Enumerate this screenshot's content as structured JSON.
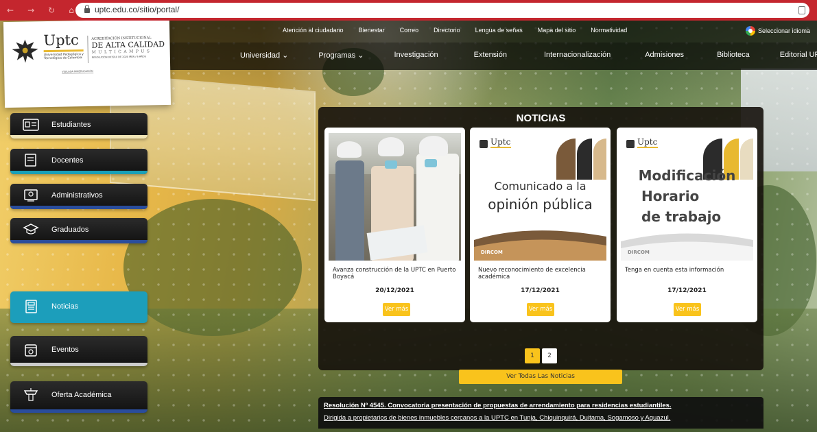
{
  "browser": {
    "url": "uptc.edu.co/sitio/portal/",
    "nav_glyphs": [
      "←",
      "→",
      "↻",
      "⌂"
    ]
  },
  "topbar": {
    "links": [
      "Atención al ciudadano",
      "Bienestar",
      "Correo",
      "Directorio",
      "Lengua de señas",
      "Mapa del sitio",
      "Normatividad"
    ],
    "language": "Seleccionar idioma"
  },
  "mainnav": {
    "items": [
      "Universidad ⌄",
      "Programas ⌄",
      "Investigación",
      "Extensión",
      "Internacionalización",
      "Admisiones",
      "Biblioteca",
      "Editorial UPTC"
    ]
  },
  "logo": {
    "wordmark": "Uptc",
    "university": "Universidad Pedagógica y Tecnológica de Colombia",
    "acred_small": "ACREDITACIÓN INSTITUCIONAL",
    "acred_big": "DE ALTA CALIDAD",
    "multicampus": "MULTICAMPUS",
    "resolution": "RESOLUCIÓN 003910 DE 2020 MEN / 6 AÑOS",
    "link": "VIGILADA MINEDUCACIÓN"
  },
  "sidebar": {
    "items": [
      {
        "label": "Estudiantes",
        "icon": "id-card-icon",
        "stripe": "#f1e5b6"
      },
      {
        "label": "Docentes",
        "icon": "book-icon",
        "stripe": "#1aa0b8"
      },
      {
        "label": "Administrativos",
        "icon": "badge-icon",
        "stripe": "#2a4d9c"
      },
      {
        "label": "Graduados",
        "icon": "graduation-cap-icon",
        "stripe": "#2a4d9c"
      },
      {
        "label": "Noticias",
        "icon": "newspaper-icon",
        "stripe": "#1c9ebb"
      },
      {
        "label": "Eventos",
        "icon": "calendar-icon",
        "stripe": "#cccccc"
      },
      {
        "label": "Oferta Académica",
        "icon": "diploma-icon",
        "stripe": "#2a4d9c"
      }
    ]
  },
  "news": {
    "title": "NOTICIAS",
    "cards": [
      {
        "text": "Avanza construcción de la UPTC en Puerto Boyacá",
        "date": "20/12/2021",
        "button": "Ver más"
      },
      {
        "text": "Nuevo reconocimiento de excelencia académica",
        "date": "17/12/2021",
        "button": "Ver más",
        "poster_line1": "Comunicado a la",
        "poster_line2": "opinión pública",
        "poster_tag": "DIRCOM"
      },
      {
        "text": "Tenga en cuenta esta información",
        "date": "17/12/2021",
        "button": "Ver más",
        "poster_line1": "Modificación",
        "poster_line2": "Horario",
        "poster_line3": "de trabajo",
        "poster_tag": "DIRCOM"
      }
    ],
    "pages": [
      "1",
      "2"
    ],
    "all_button": "Ver Todas Las Noticias"
  },
  "poster_logo": "Uptc",
  "announcement": {
    "line1": "Resolución Nº 4545. Convocatoria presentación de propuestas de arrendamiento para residencias estudiantiles.",
    "line2": "Dirigida a propietarios de bienes inmuebles cercanos a la UPTC en Tunja, Chiquinquirá, Duitama, Sogamoso y Aguazul."
  },
  "colors": {
    "browser_bar": "#c4262e",
    "accent_yellow": "#f9c31c",
    "accent_teal": "#1c9ebb",
    "accent_blue": "#2a4d9c"
  }
}
